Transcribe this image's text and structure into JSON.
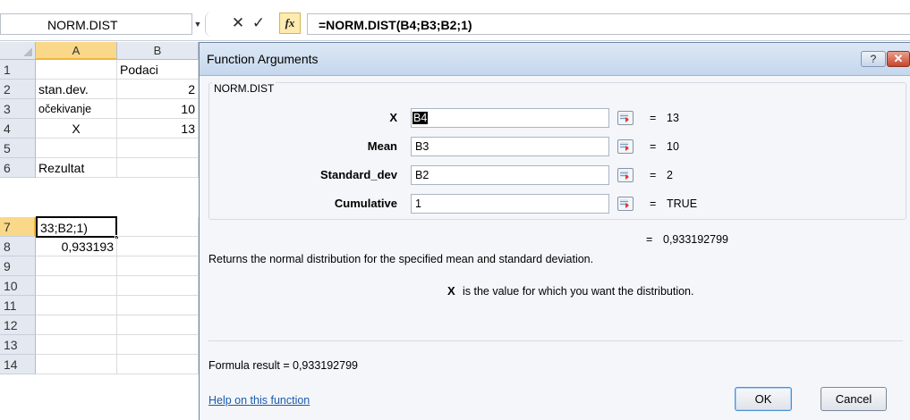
{
  "formula_bar": {
    "name_box": "NORM.DIST",
    "dropdown_glyph": "▼",
    "cancel_glyph": "✕",
    "enter_glyph": "✓",
    "fx_glyph": "fx",
    "formula": "=NORM.DIST(B4;B3;B2;1)"
  },
  "sheet": {
    "columns": [
      "A",
      "B"
    ],
    "active_column": "A",
    "active_cell": "A7",
    "rows": [
      {
        "num": "1",
        "a": "",
        "b": "Podaci"
      },
      {
        "num": "2",
        "a": "stan.dev.",
        "b": "2"
      },
      {
        "num": "3",
        "a": "očekivanje",
        "b": "10"
      },
      {
        "num": "4",
        "a": "X",
        "b": "13"
      },
      {
        "num": "5",
        "a": "",
        "b": ""
      },
      {
        "num": "6",
        "a": "Rezultat",
        "b": ""
      },
      {
        "num": "7",
        "a": "33;B2;1)",
        "b": ""
      },
      {
        "num": "8",
        "a": "0,933193",
        "b": ""
      },
      {
        "num": "9",
        "a": "",
        "b": ""
      },
      {
        "num": "10",
        "a": "",
        "b": ""
      },
      {
        "num": "11",
        "a": "",
        "b": ""
      },
      {
        "num": "12",
        "a": "",
        "b": ""
      },
      {
        "num": "13",
        "a": "",
        "b": ""
      },
      {
        "num": "14",
        "a": "",
        "b": ""
      }
    ]
  },
  "dialog": {
    "title": "Function Arguments",
    "help_glyph": "?",
    "close_glyph": "✕",
    "function_name": "NORM.DIST",
    "args": [
      {
        "label": "X",
        "input": "B4",
        "value": "13"
      },
      {
        "label": "Mean",
        "input": "B3",
        "value": "10"
      },
      {
        "label": "Standard_dev",
        "input": "B2",
        "value": "2"
      },
      {
        "label": "Cumulative",
        "input": "1",
        "value": "TRUE"
      }
    ],
    "equals_sign": "=",
    "result": "0,933192799",
    "description": "Returns the normal distribution for the specified mean and standard deviation.",
    "arg_help_name": "X",
    "arg_help_text": "is the value for which you want the distribution.",
    "formula_result_label": "Formula result =",
    "formula_result_value": "0,933192799",
    "help_link": "Help on this function",
    "ok_label": "OK",
    "cancel_label": "Cancel"
  }
}
